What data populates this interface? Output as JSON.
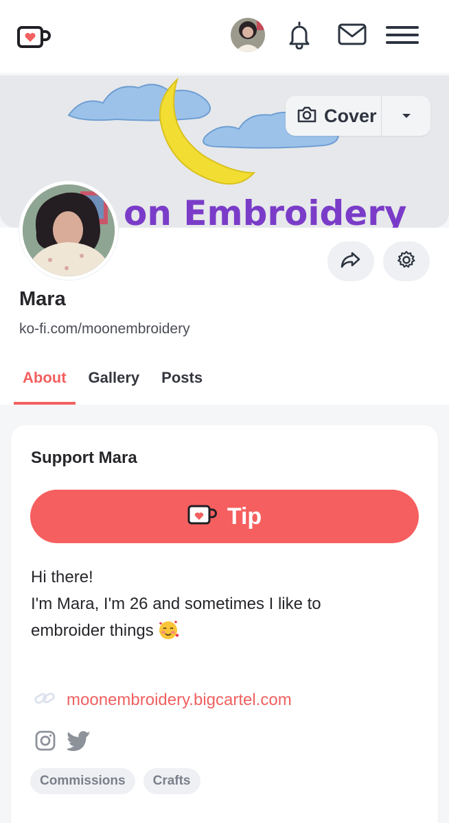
{
  "header": {
    "logo_icon": "ko-fi-cup-icon",
    "avatar_icon": "user-avatar",
    "notifications_icon": "bell-icon",
    "messages_icon": "mail-icon",
    "menu_icon": "hamburger-menu-icon"
  },
  "cover": {
    "button_label": "Cover",
    "button_icon": "camera-icon",
    "dropdown_icon": "caret-down-icon",
    "banner_text": "on Embroidery"
  },
  "profile": {
    "name": "Mara",
    "url": "ko-fi.com/moonembroidery",
    "share_icon": "share-icon",
    "settings_icon": "gear-icon"
  },
  "tabs": [
    {
      "label": "About",
      "active": true
    },
    {
      "label": "Gallery",
      "active": false
    },
    {
      "label": "Posts",
      "active": false
    }
  ],
  "support": {
    "title": "Support Mara",
    "tip_label": "Tip",
    "bio_line1": "Hi there!",
    "bio_line2": "I'm Mara, I'm 26 and sometimes I like to",
    "bio_line3": "embroider things",
    "bio_emoji": "smiling-face-with-hearts",
    "link": "moonembroidery.bigcartel.com",
    "tags": [
      "Commissions",
      "Crafts"
    ]
  },
  "colors": {
    "accent": "#f2605f",
    "tip_button": "#f65f5f",
    "text": "#26262b",
    "background": "#f5f6f8"
  }
}
